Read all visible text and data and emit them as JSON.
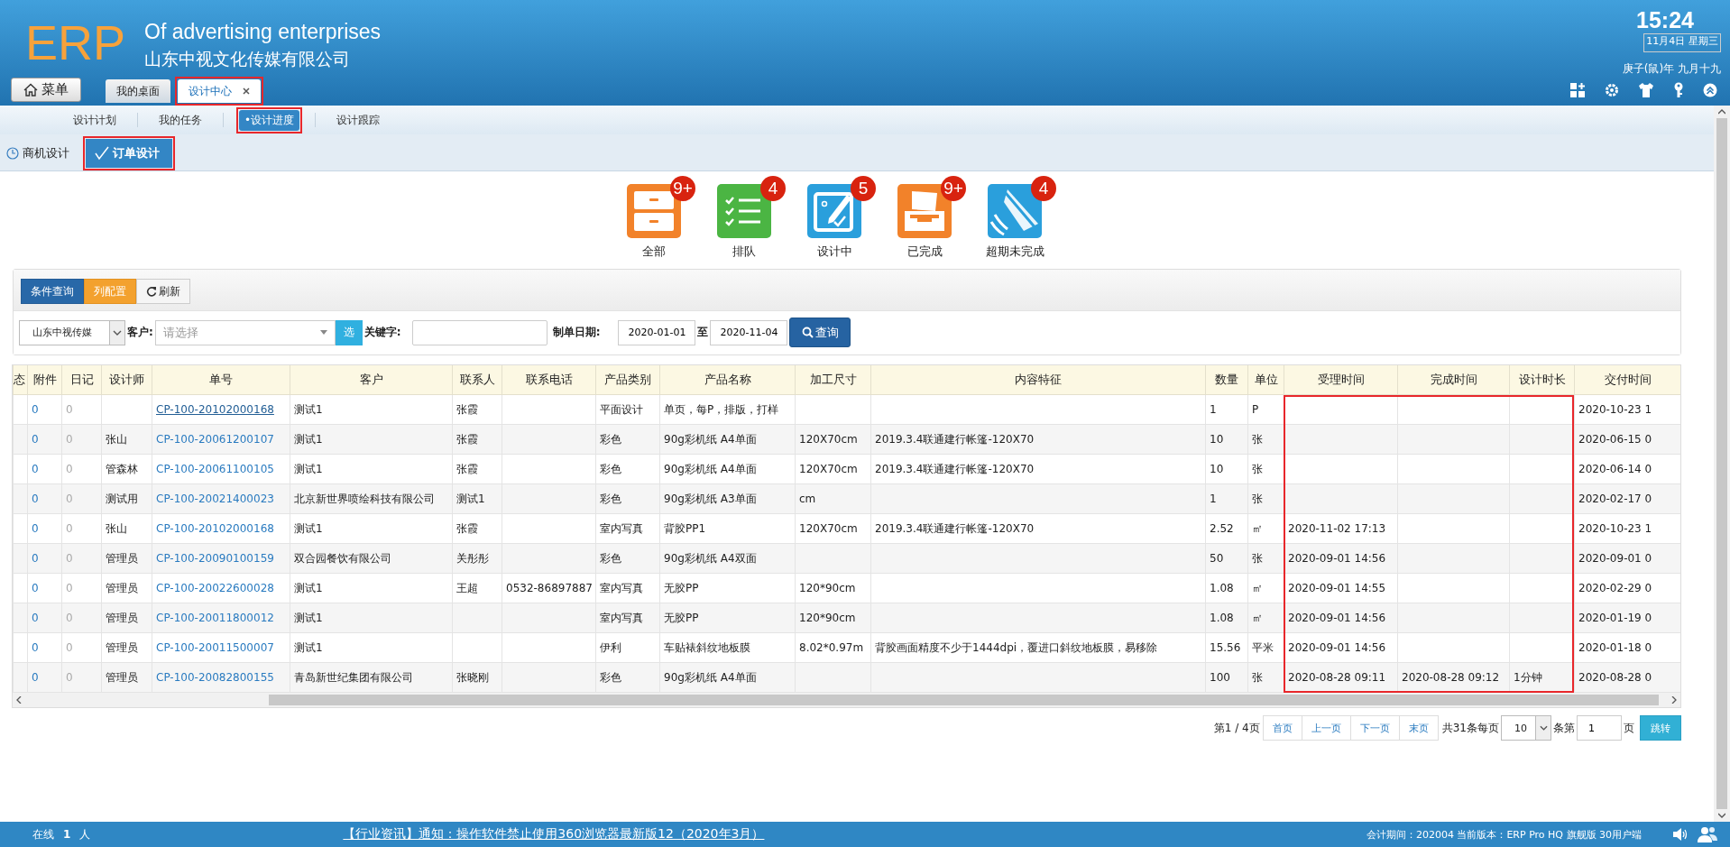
{
  "header": {
    "logo": "ERP",
    "tagline": "Of advertising enterprises",
    "company": "山东中视文化传媒有限公司",
    "time": "15:24",
    "date": "11月4日 星期三",
    "lunar": "庚子(鼠)年 九月十九",
    "menu_button": "菜单",
    "tabs": [
      {
        "label": "我的桌面",
        "selected": false,
        "closable": false,
        "highlighted": false
      },
      {
        "label": "设计中心",
        "selected": true,
        "closable": true,
        "highlighted": true
      }
    ]
  },
  "subnav": [
    {
      "label": "设计计划",
      "selected": false,
      "highlighted": false
    },
    {
      "label": "我的任务",
      "selected": false,
      "highlighted": false
    },
    {
      "label": "•设计进度",
      "selected": true,
      "highlighted": true
    },
    {
      "label": "设计跟踪",
      "selected": false,
      "highlighted": false
    }
  ],
  "mode_tabs": [
    {
      "label": "商机设计",
      "kind": "clock",
      "selected": false,
      "highlighted": false
    },
    {
      "label": "订单设计",
      "kind": "check",
      "selected": true,
      "highlighted": true
    }
  ],
  "stats": [
    {
      "label": "全部",
      "count": "9+",
      "kind": "cabinet"
    },
    {
      "label": "排队",
      "count": "4",
      "kind": "checklist"
    },
    {
      "label": "设计中",
      "count": "5",
      "kind": "edit"
    },
    {
      "label": "已完成",
      "count": "9+",
      "kind": "inbox"
    },
    {
      "label": "超期未完成",
      "count": "4",
      "kind": "bell"
    }
  ],
  "toolbar": {
    "buttons": [
      {
        "label": "条件查询",
        "kind": "primary"
      },
      {
        "label": "列配置",
        "kind": "warning"
      },
      {
        "label": "刷新",
        "kind": "refresh"
      }
    ]
  },
  "filters": {
    "company": "山东中视传媒",
    "customer_label": "客户:",
    "customer_placeholder": "请选择",
    "pick_button": "选",
    "keyword_label": "关键字:",
    "date_label": "制单日期:",
    "date_from": "2020-01-01",
    "date_sep": "至",
    "date_to": "2020-11-04",
    "search_button": "查询"
  },
  "table": {
    "columns": [
      {
        "label": "态",
        "highlighted": false
      },
      {
        "label": "附件",
        "kind": "count",
        "highlighted": false
      },
      {
        "label": "日记",
        "kind": "muted",
        "highlighted": false
      },
      {
        "label": "设计师",
        "kind": "text",
        "highlighted": false
      },
      {
        "label": "单号",
        "kind": "link",
        "highlighted": false
      },
      {
        "label": "客户",
        "kind": "text",
        "highlighted": false
      },
      {
        "label": "联系人",
        "kind": "text",
        "highlighted": false
      },
      {
        "label": "联系电话",
        "kind": "text",
        "highlighted": false
      },
      {
        "label": "产品类别",
        "kind": "text",
        "highlighted": false
      },
      {
        "label": "产品名称",
        "kind": "text",
        "highlighted": false
      },
      {
        "label": "加工尺寸",
        "kind": "text",
        "highlighted": false
      },
      {
        "label": "内容特征",
        "kind": "text",
        "highlighted": false
      },
      {
        "label": "数量",
        "kind": "text",
        "highlighted": false
      },
      {
        "label": "单位",
        "kind": "text",
        "highlighted": false
      },
      {
        "label": "受理时间",
        "kind": "text",
        "highlighted": true
      },
      {
        "label": "完成时间",
        "kind": "text",
        "highlighted": true
      },
      {
        "label": "设计时长",
        "kind": "text",
        "highlighted": true
      },
      {
        "label": "交付时间",
        "kind": "text",
        "highlighted": false
      }
    ],
    "rows": [
      {
        "hovered": true,
        "cells": [
          null,
          "0",
          "0",
          null,
          "CP-100-20102000168",
          "测试1",
          "张霞",
          null,
          "平面设计",
          "单页，每P，排版，打样",
          null,
          null,
          "1",
          "P",
          null,
          null,
          null,
          "2020-10-23 1"
        ]
      },
      {
        "hovered": false,
        "cells": [
          null,
          "0",
          "0",
          "张山",
          "CP-100-20061200107",
          "测试1",
          "张霞",
          null,
          "彩色",
          "90g彩机纸 A4单面",
          "120X70cm",
          "2019.3.4联通建行帐篷-120X70",
          "10",
          "张",
          null,
          null,
          null,
          "2020-06-15 0"
        ]
      },
      {
        "hovered": false,
        "cells": [
          null,
          "0",
          "0",
          "管森林",
          "CP-100-20061100105",
          "测试1",
          "张霞",
          null,
          "彩色",
          "90g彩机纸 A4单面",
          "120X70cm",
          "2019.3.4联通建行帐篷-120X70",
          "10",
          "张",
          null,
          null,
          null,
          "2020-06-14 0"
        ]
      },
      {
        "hovered": false,
        "cells": [
          null,
          "0",
          "0",
          "测试用",
          "CP-100-20021400023",
          "北京新世界喷绘科技有限公司",
          "测试1",
          null,
          "彩色",
          "90g彩机纸 A3单面",
          "cm",
          null,
          "1",
          "张",
          null,
          null,
          null,
          "2020-02-17 0"
        ]
      },
      {
        "hovered": false,
        "cells": [
          null,
          "0",
          "0",
          "张山",
          "CP-100-20102000168",
          "测试1",
          "张霞",
          null,
          "室内写真",
          "背胶PP1",
          "120X70cm",
          "2019.3.4联通建行帐篷-120X70",
          "2.52",
          "㎡",
          "2020-11-02 17:13",
          null,
          null,
          "2020-10-23 1"
        ]
      },
      {
        "hovered": false,
        "cells": [
          null,
          "0",
          "0",
          "管理员",
          "CP-100-20090100159",
          "双合园餐饮有限公司",
          "关彤彤",
          null,
          "彩色",
          "90g彩机纸 A4双面",
          null,
          null,
          "50",
          "张",
          "2020-09-01 14:56",
          null,
          null,
          "2020-09-01 0"
        ]
      },
      {
        "hovered": false,
        "cells": [
          null,
          "0",
          "0",
          "管理员",
          "CP-100-20022600028",
          "测试1",
          "王超",
          "0532-86897887",
          "室内写真",
          "无胶PP",
          "120*90cm",
          null,
          "1.08",
          "㎡",
          "2020-09-01 14:55",
          null,
          null,
          "2020-02-29 0"
        ]
      },
      {
        "hovered": false,
        "cells": [
          null,
          "0",
          "0",
          "管理员",
          "CP-100-20011800012",
          "测试1",
          null,
          null,
          "室内写真",
          "无胶PP",
          "120*90cm",
          null,
          "1.08",
          "㎡",
          "2020-09-01 14:56",
          null,
          null,
          "2020-01-19 0"
        ]
      },
      {
        "hovered": false,
        "cells": [
          null,
          "0",
          "0",
          "管理员",
          "CP-100-20011500007",
          "测试1",
          null,
          null,
          "伊利",
          "车贴裱斜纹地板膜",
          "8.02*0.97m",
          "背胶画面精度不少于1444dpi，覆进口斜纹地板膜，易移除",
          "15.56",
          "平米",
          "2020-09-01 14:56",
          null,
          null,
          "2020-01-18 0"
        ]
      },
      {
        "hovered": false,
        "cells": [
          null,
          "0",
          "0",
          "管理员",
          "CP-100-20082800155",
          "青岛新世纪集团有限公司",
          "张晓刚",
          null,
          "彩色",
          "90g彩机纸 A4单面",
          null,
          null,
          "100",
          "张",
          "2020-08-28 09:11",
          "2020-08-28 09:12",
          "1分钟",
          "2020-08-28 0"
        ]
      }
    ]
  },
  "pager": {
    "info": "第1 / 4页",
    "buttons": [
      "首页",
      "上一页",
      "下一页",
      "末页"
    ],
    "total": "共31条每页",
    "page_size": "10",
    "page_label": "条第",
    "page": "1",
    "page_suffix": "页",
    "go_button": "跳转"
  },
  "footer": {
    "online_label": "在线",
    "online_count": "1",
    "online_unit": "人",
    "notice": "【行业资讯】通知：操作软件禁止使用360浏览器最新版12（2020年3月）",
    "version": "会计期间：202004 当前版本：ERP Pro HQ 旗舰版 30用户端"
  }
}
